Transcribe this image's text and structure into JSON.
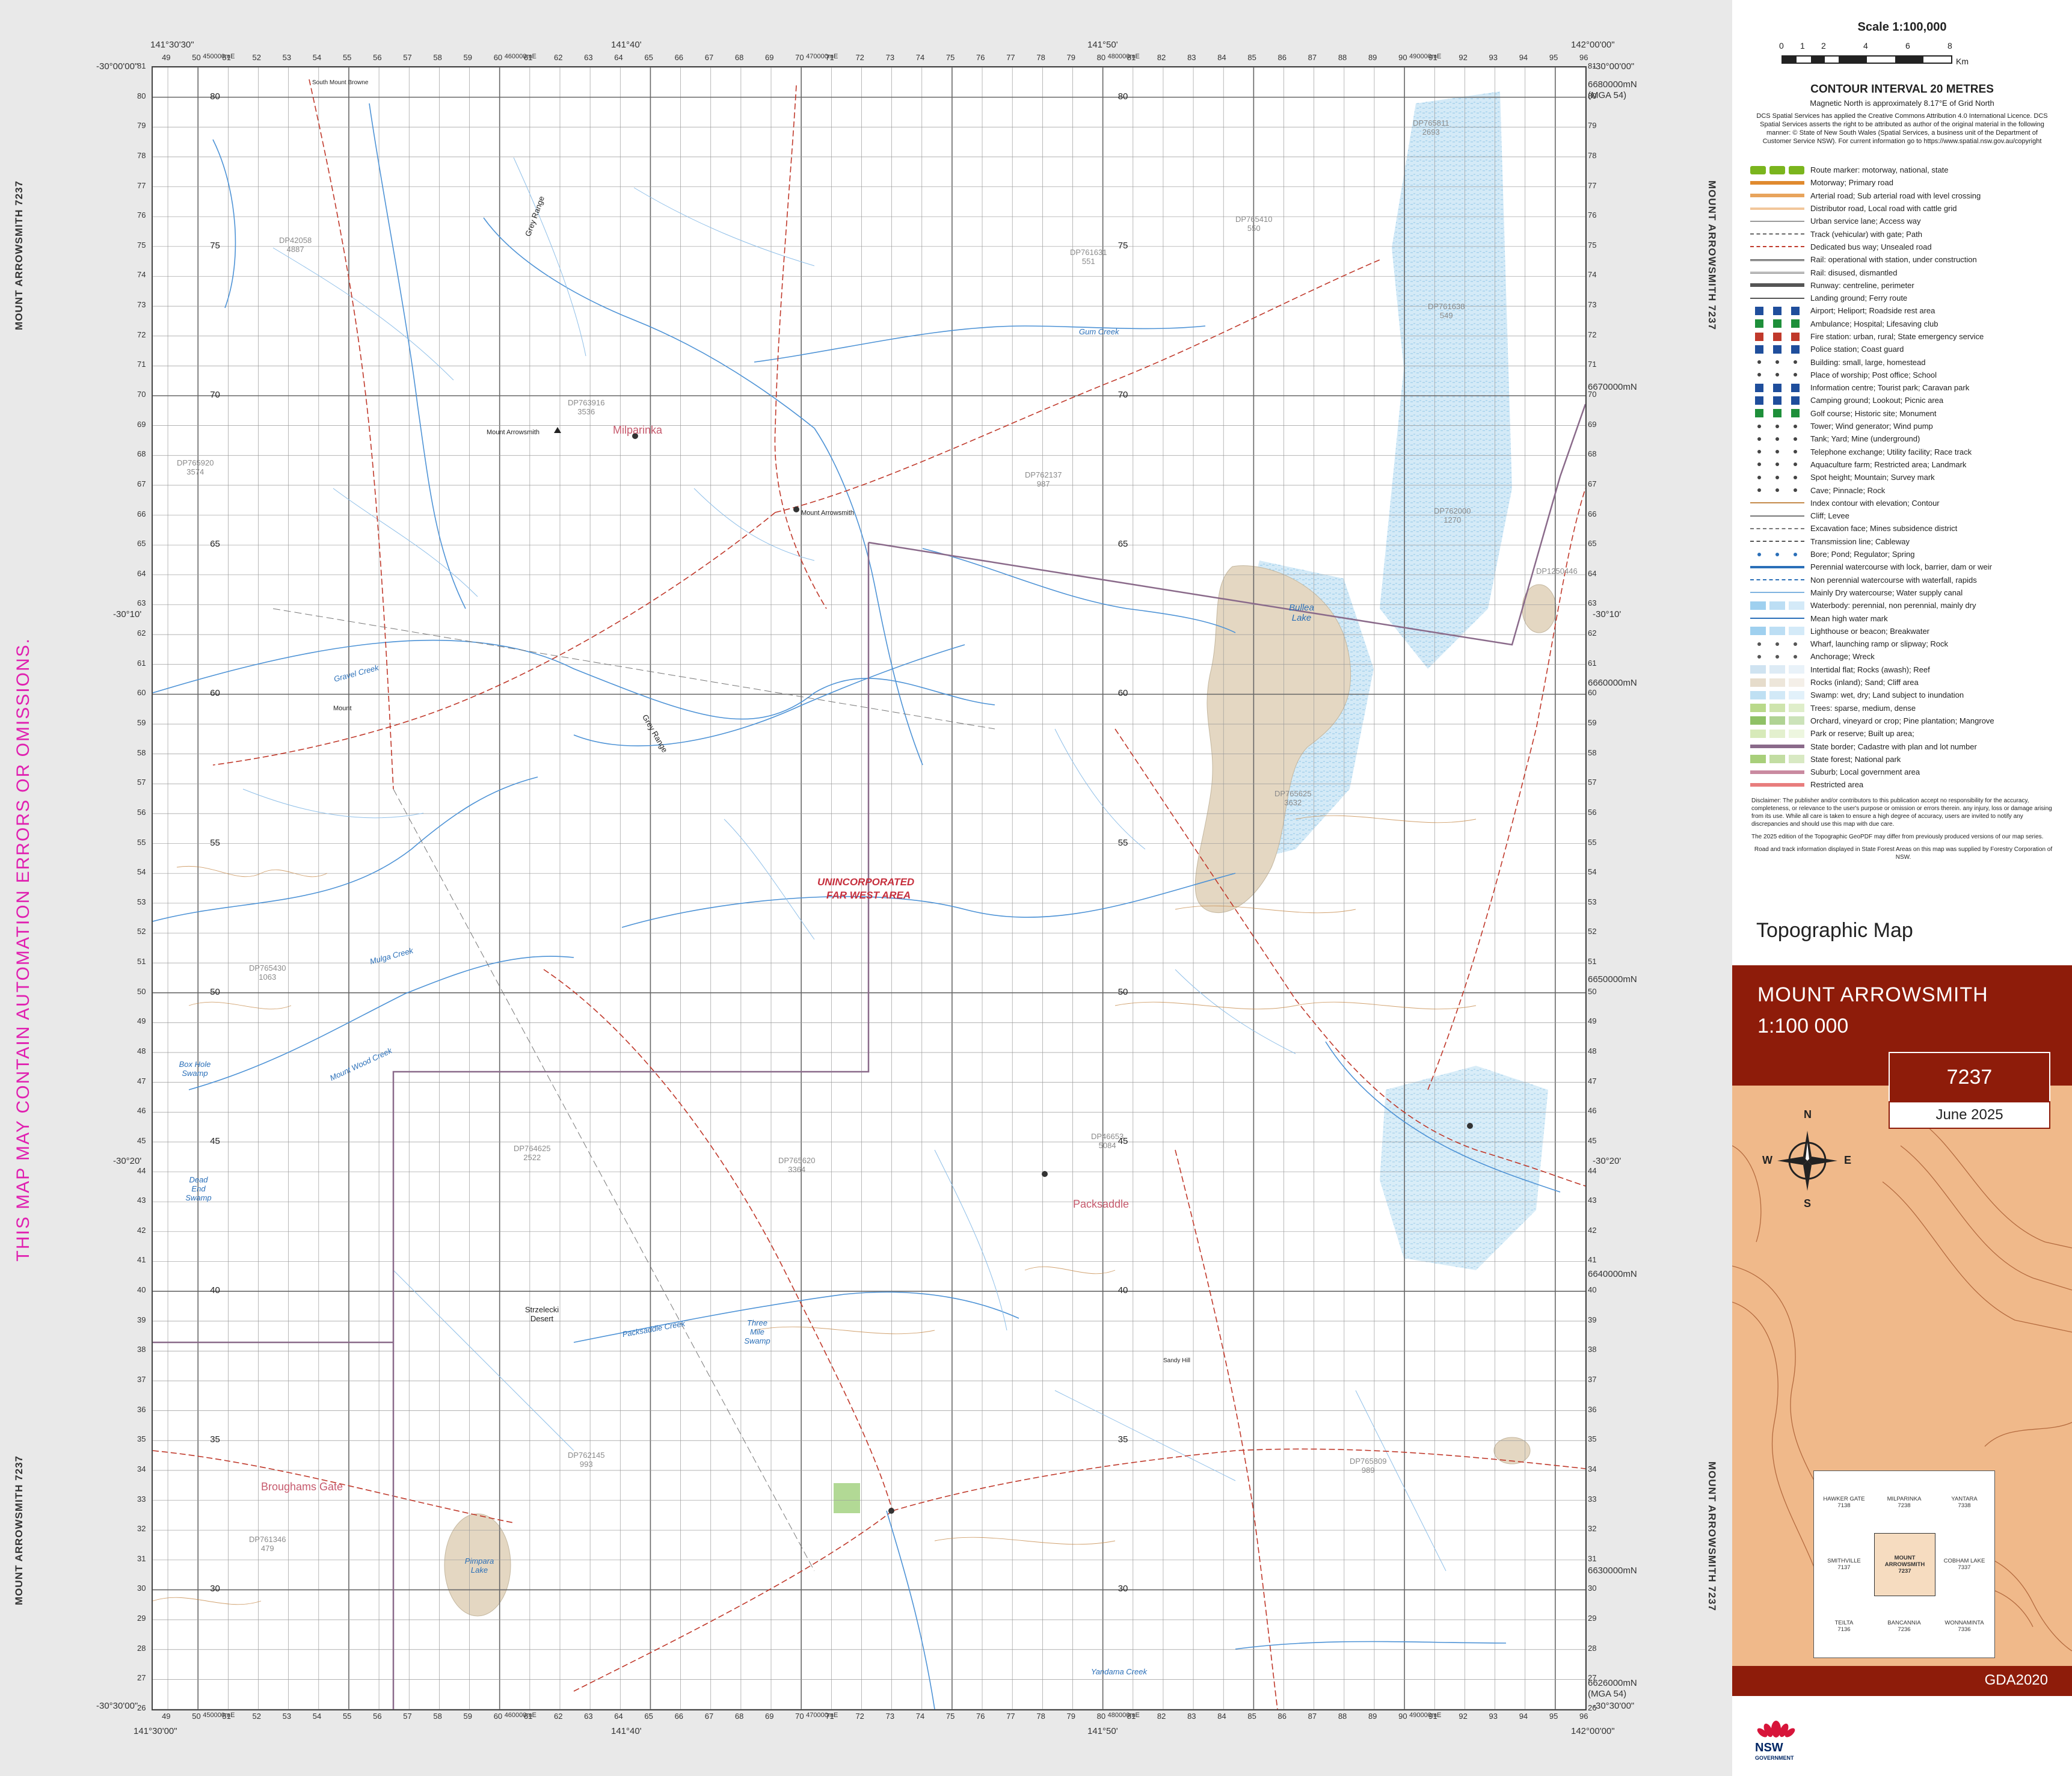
{
  "warning": "THIS MAP MAY CONTAIN AUTOMATION ERRORS OR OMISSIONS.",
  "margin_labels": {
    "left_top": "MOUNT ARROWSMITH 7237",
    "left_bottom": "MOUNT ARROWSMITH 7237",
    "right_top": "MOUNT ARROWSMITH 7237",
    "right_bottom": "MOUNT ARROWSMITH 7237"
  },
  "corners": {
    "tl_lat": "-30°00'00\"",
    "tr_lat": "-30°00'00\"",
    "bl_lat": "-30°30'00\"",
    "br_lat": "-30°30'00\"",
    "lat_mid_10_left": "-30°10'",
    "lat_mid_10_right": "-30°10'",
    "lat_mid_20_left": "-30°20'",
    "lat_mid_20_right": "-30°20'",
    "top_lon_left": "141°30'30\"",
    "top_lon_40": "141°40'",
    "top_lon_50": "141°50'",
    "top_lon_right": "142°00'00\"",
    "bottom_lon_left": "141°30'00\"",
    "bottom_lon_40": "141°40'",
    "bottom_lon_50": "141°50'",
    "bottom_lon_right": "142°00'00\""
  },
  "easting_ticks": [
    "49",
    "50",
    "51",
    "52",
    "53",
    "54",
    "55",
    "56",
    "57",
    "58",
    "59",
    "60",
    "61",
    "62",
    "63",
    "64",
    "65",
    "66",
    "67",
    "68",
    "69",
    "70",
    "71",
    "72",
    "73",
    "74",
    "75",
    "76",
    "77",
    "78",
    "79",
    "80",
    "81",
    "82",
    "83",
    "84",
    "85",
    "86",
    "87",
    "88",
    "89",
    "90",
    "91",
    "92",
    "93",
    "94",
    "95",
    "96"
  ],
  "northing_ticks": [
    "81",
    "80",
    "79",
    "78",
    "77",
    "76",
    "75",
    "74",
    "73",
    "72",
    "71",
    "70",
    "69",
    "68",
    "67",
    "66",
    "65",
    "64",
    "63",
    "62",
    "61",
    "60",
    "59",
    "58",
    "57",
    "56",
    "55",
    "54",
    "53",
    "52",
    "51",
    "50",
    "49",
    "48",
    "47",
    "46",
    "45",
    "44",
    "43",
    "42",
    "41",
    "40",
    "39",
    "38",
    "37",
    "36",
    "35",
    "34",
    "33",
    "32",
    "31",
    "30",
    "29",
    "28",
    "27",
    "26"
  ],
  "northing_major": {
    "n80": "6680000mN",
    "n70": "6670000mN",
    "n60": "6660000mN",
    "n50": "6650000mN",
    "n40": "6640000mN",
    "n30": "6630000mN",
    "n26": "6626000mN",
    "mga": "(MGA 54)"
  },
  "easting_major": {
    "e50": "450000mE",
    "e60": "460000mE",
    "e70": "470000mE",
    "e80": "480000mE",
    "e90": "490000mE"
  },
  "map_labels": {
    "milparinka": "Milparinka",
    "mount_arrowsmith": "Mount Arrowsmith",
    "packsaddle": "Packsaddle",
    "broughams_gate": "Broughams Gate",
    "unincorporated": "UNINCORPORATED",
    "far_west_area": "FAR WEST AREA",
    "bullea_lake": "Bullea Lake",
    "pimpara_lake": "Pimpara Lake",
    "box_hole_swamp": "Box Hole Swamp",
    "dead_end_swamp": "Dead End Swamp",
    "three_mile_swamp": "Three Mile Swamp",
    "strzelecki_desert": "Strzelecki Desert",
    "grey_range": "Grey Range",
    "gum_creek": "Gum Creek",
    "packsaddle_creek": "Packsaddle Creek",
    "mulga_creek": "Mulga Creek",
    "mount_wood_creek": "Mount Wood Creek",
    "gravel_creek": "Gravel Creek",
    "yandama_creek": "Yandama Creek",
    "south_mount_browne": "South Mount Browne",
    "mount": "Mount",
    "sandy_hill": "Sandy Hill"
  },
  "parcels": [
    {
      "dp": "DP42058",
      "num": "4887"
    },
    {
      "dp": "DP765920",
      "num": "3574"
    },
    {
      "dp": "DP763916",
      "num": "3536"
    },
    {
      "dp": "DP762137",
      "num": "987"
    },
    {
      "dp": "DP761631",
      "num": "551"
    },
    {
      "dp": "DP765410",
      "num": "550"
    },
    {
      "dp": "DP761638",
      "num": "549"
    },
    {
      "dp": "DP765625",
      "num": "3632"
    },
    {
      "dp": "DP764625",
      "num": "2522"
    },
    {
      "dp": "DP765620",
      "num": "3364"
    },
    {
      "dp": "DP46653",
      "num": "5084"
    },
    {
      "dp": "DP762145",
      "num": "993"
    },
    {
      "dp": "DP765809",
      "num": "989"
    },
    {
      "dp": "DP761346",
      "num": "479"
    },
    {
      "dp": "DP765430",
      "num": "1063"
    },
    {
      "dp": "DP765811",
      "num": "2693"
    },
    {
      "dp": "DP762000",
      "num": "1270"
    },
    {
      "dp": "DP1250446",
      "num": ""
    }
  ],
  "grid_labels_inside": [
    "80",
    "75",
    "70",
    "65",
    "60",
    "55",
    "50",
    "45",
    "40",
    "35",
    "30"
  ],
  "panel": {
    "scale_title": "Scale 1:100,000",
    "scale_numbers": [
      "0",
      "1",
      "2",
      "4",
      "6",
      "8"
    ],
    "scale_unit": "Km",
    "contour_interval": "CONTOUR INTERVAL 20 METRES",
    "magnetic": "Magnetic North is approximately 8.17°E of Grid North",
    "credit": "DCS Spatial Services has applied the Creative Commons Attribution 4.0 International Licence. DCS Spatial Services asserts the right to be attributed as author of the original material in the following manner: © State of New South Wales (Spatial Services, a business unit of the Department of Customer Service NSW). For current information go to https://www.spatial.nsw.gov.au/copyright",
    "legend": [
      {
        "label": "Route marker: motorway, national, state",
        "color": "#7ab51d",
        "kind": "badge"
      },
      {
        "label": "Motorway; Primary road",
        "color": "#e08a2e",
        "kind": "thick"
      },
      {
        "label": "Arterial road; Sub arterial road with level crossing",
        "color": "#e8a45c",
        "kind": "thick"
      },
      {
        "label": "Distributor road, Local road with cattle grid",
        "color": "#f2c79b",
        "kind": "medium"
      },
      {
        "label": "Urban service lane; Access way",
        "color": "#999999",
        "kind": "thin"
      },
      {
        "label": "Track (vehicular) with gate; Path",
        "color": "#666666",
        "kind": "dash"
      },
      {
        "label": "Dedicated bus way; Unsealed road",
        "color": "#c0392b",
        "kind": "dash"
      },
      {
        "label": "Rail: operational with station, under construction",
        "color": "#333333",
        "kind": "rail"
      },
      {
        "label": "Rail: disused, dismantled",
        "color": "#777777",
        "kind": "rail"
      },
      {
        "label": "Runway: centreline, perimeter",
        "color": "#555555",
        "kind": "thick"
      },
      {
        "label": "Landing ground; Ferry route",
        "color": "#555555",
        "kind": "thin"
      },
      {
        "label": "Airport; Heliport; Roadside rest area",
        "color": "#1f4e9c",
        "kind": "icons"
      },
      {
        "label": "Ambulance; Hospital; Lifesaving club",
        "color": "#1e8f3a",
        "kind": "icons"
      },
      {
        "label": "Fire station: urban, rural; State emergency service",
        "color": "#c0392b",
        "kind": "icons"
      },
      {
        "label": "Police station; Coast guard",
        "color": "#1f4e9c",
        "kind": "icons"
      },
      {
        "label": "Building: small, large, homestead",
        "color": "#444444",
        "kind": "dots"
      },
      {
        "label": "Place of worship; Post office; School",
        "color": "#444444",
        "kind": "dots"
      },
      {
        "label": "Information centre; Tourist park; Caravan park",
        "color": "#1f4e9c",
        "kind": "icons"
      },
      {
        "label": "Camping ground; Lookout; Picnic area",
        "color": "#1f4e9c",
        "kind": "icons"
      },
      {
        "label": "Golf course; Historic site; Monument",
        "color": "#1e8f3a",
        "kind": "icons"
      },
      {
        "label": "Tower; Wind generator; Wind pump",
        "color": "#444444",
        "kind": "dots"
      },
      {
        "label": "Tank; Yard; Mine (underground)",
        "color": "#444444",
        "kind": "dots"
      },
      {
        "label": "Telephone exchange; Utility facility; Race track",
        "color": "#444444",
        "kind": "dots"
      },
      {
        "label": "Aquaculture farm; Restricted area; Landmark",
        "color": "#444444",
        "kind": "dots"
      },
      {
        "label": "Spot height; Mountain; Survey mark",
        "color": "#444444",
        "kind": "dots"
      },
      {
        "label": "Cave; Pinnacle; Rock",
        "color": "#444444",
        "kind": "dots"
      },
      {
        "label": "Index contour with elevation; Contour",
        "color": "#c58a4a",
        "kind": "thin"
      },
      {
        "label": "Cliff; Levee",
        "color": "#777777",
        "kind": "thin"
      },
      {
        "label": "Excavation face; Mines subsidence district",
        "color": "#777777",
        "kind": "dash"
      },
      {
        "label": "Transmission line; Cableway",
        "color": "#555555",
        "kind": "dash"
      },
      {
        "label": "Bore; Pond; Regulator; Spring",
        "color": "#2a6fb8",
        "kind": "dots"
      },
      {
        "label": "Perennial watercourse with lock, barrier, dam or weir",
        "color": "#2a6fb8",
        "kind": "medium"
      },
      {
        "label": "Non perennial watercourse with waterfall, rapids",
        "color": "#2a6fb8",
        "kind": "dash"
      },
      {
        "label": "Mainly Dry watercourse; Water supply canal",
        "color": "#7fb3e0",
        "kind": "thin"
      },
      {
        "label": "Waterbody: perennial, non perennial, mainly dry",
        "color": "#9fd0ef",
        "kind": "fill"
      },
      {
        "label": "Mean high water mark",
        "color": "#2a6fb8",
        "kind": "thin"
      },
      {
        "label": "Lighthouse or beacon; Breakwater",
        "color": "#9fd0ef",
        "kind": "fill"
      },
      {
        "label": "Wharf, launching ramp or slipway; Rock",
        "color": "#555555",
        "kind": "dots"
      },
      {
        "label": "Anchorage; Wreck",
        "color": "#555555",
        "kind": "dots"
      },
      {
        "label": "Intertidal flat; Rocks (awash); Reef",
        "color": "#cfe3f1",
        "kind": "fill"
      },
      {
        "label": "Rocks (inland); Sand; Cliff area",
        "color": "#e6dccb",
        "kind": "fill"
      },
      {
        "label": "Swamp: wet, dry; Land subject to inundation",
        "color": "#bfe0f3",
        "kind": "fill"
      },
      {
        "label": "Trees: sparse, medium, dense",
        "color": "#b9d98a",
        "kind": "fill"
      },
      {
        "label": "Orchard, vineyard or crop; Pine plantation; Mangrove",
        "color": "#8fc166",
        "kind": "fill"
      },
      {
        "label": "Park or reserve; Built up area;",
        "color": "#d7eab9",
        "kind": "fill"
      },
      {
        "label": "State border; Cadastre with plan and lot number",
        "color": "#8a6a8a",
        "kind": "thick"
      },
      {
        "label": "State forest; National park",
        "color": "#a8cf7a",
        "kind": "fill"
      },
      {
        "label": "Suburb; Local government area",
        "color": "#c98aa0",
        "kind": "thick"
      },
      {
        "label": "Restricted area",
        "color": "#e87d7d",
        "kind": "thick"
      }
    ],
    "disclaimer": "Disclaimer: The publisher and/or contributors to this publication accept no responsibility for the accuracy, completeness, or relevance to the user's purpose or omission or errors therein. any injury, loss or damage arising from its use. While all care is taken to ensure a high degree of accuracy, users are invited to notify any discrepancies and should use this map with due care.",
    "edition_note": "The 2025 edition of the Topographic GeoPDF may differ from previously produced versions of our map series.",
    "road_note": "Road and track information displayed in State Forest Areas on this map was supplied by Forestry Corporation of NSW.",
    "topo_title": "Topographic Map",
    "sheet_name": "MOUNT ARROWSMITH",
    "sheet_scale": "1:100 000",
    "sheet_number": "7237",
    "sheet_date": "June 2025",
    "compass": {
      "n": "N",
      "s": "S",
      "e": "E",
      "w": "W"
    },
    "index": [
      {
        "name": "HAWKER GATE",
        "num": "7138"
      },
      {
        "name": "MILPARINKA",
        "num": "7238"
      },
      {
        "name": "YANTARA",
        "num": "7338"
      },
      {
        "name": "SMITHVILLE",
        "num": "7137"
      },
      {
        "name": "MOUNT ARROWSMITH",
        "num": "7237"
      },
      {
        "name": "COBHAM LAKE",
        "num": "7337"
      },
      {
        "name": "TEILTA",
        "num": "7136"
      },
      {
        "name": "BANCANNIA",
        "num": "7236"
      },
      {
        "name": "WONNAMINTA",
        "num": "7336"
      }
    ],
    "gda": "GDA2020",
    "nsw": "NSW",
    "nsw_sub": "GOVERNMENT"
  }
}
